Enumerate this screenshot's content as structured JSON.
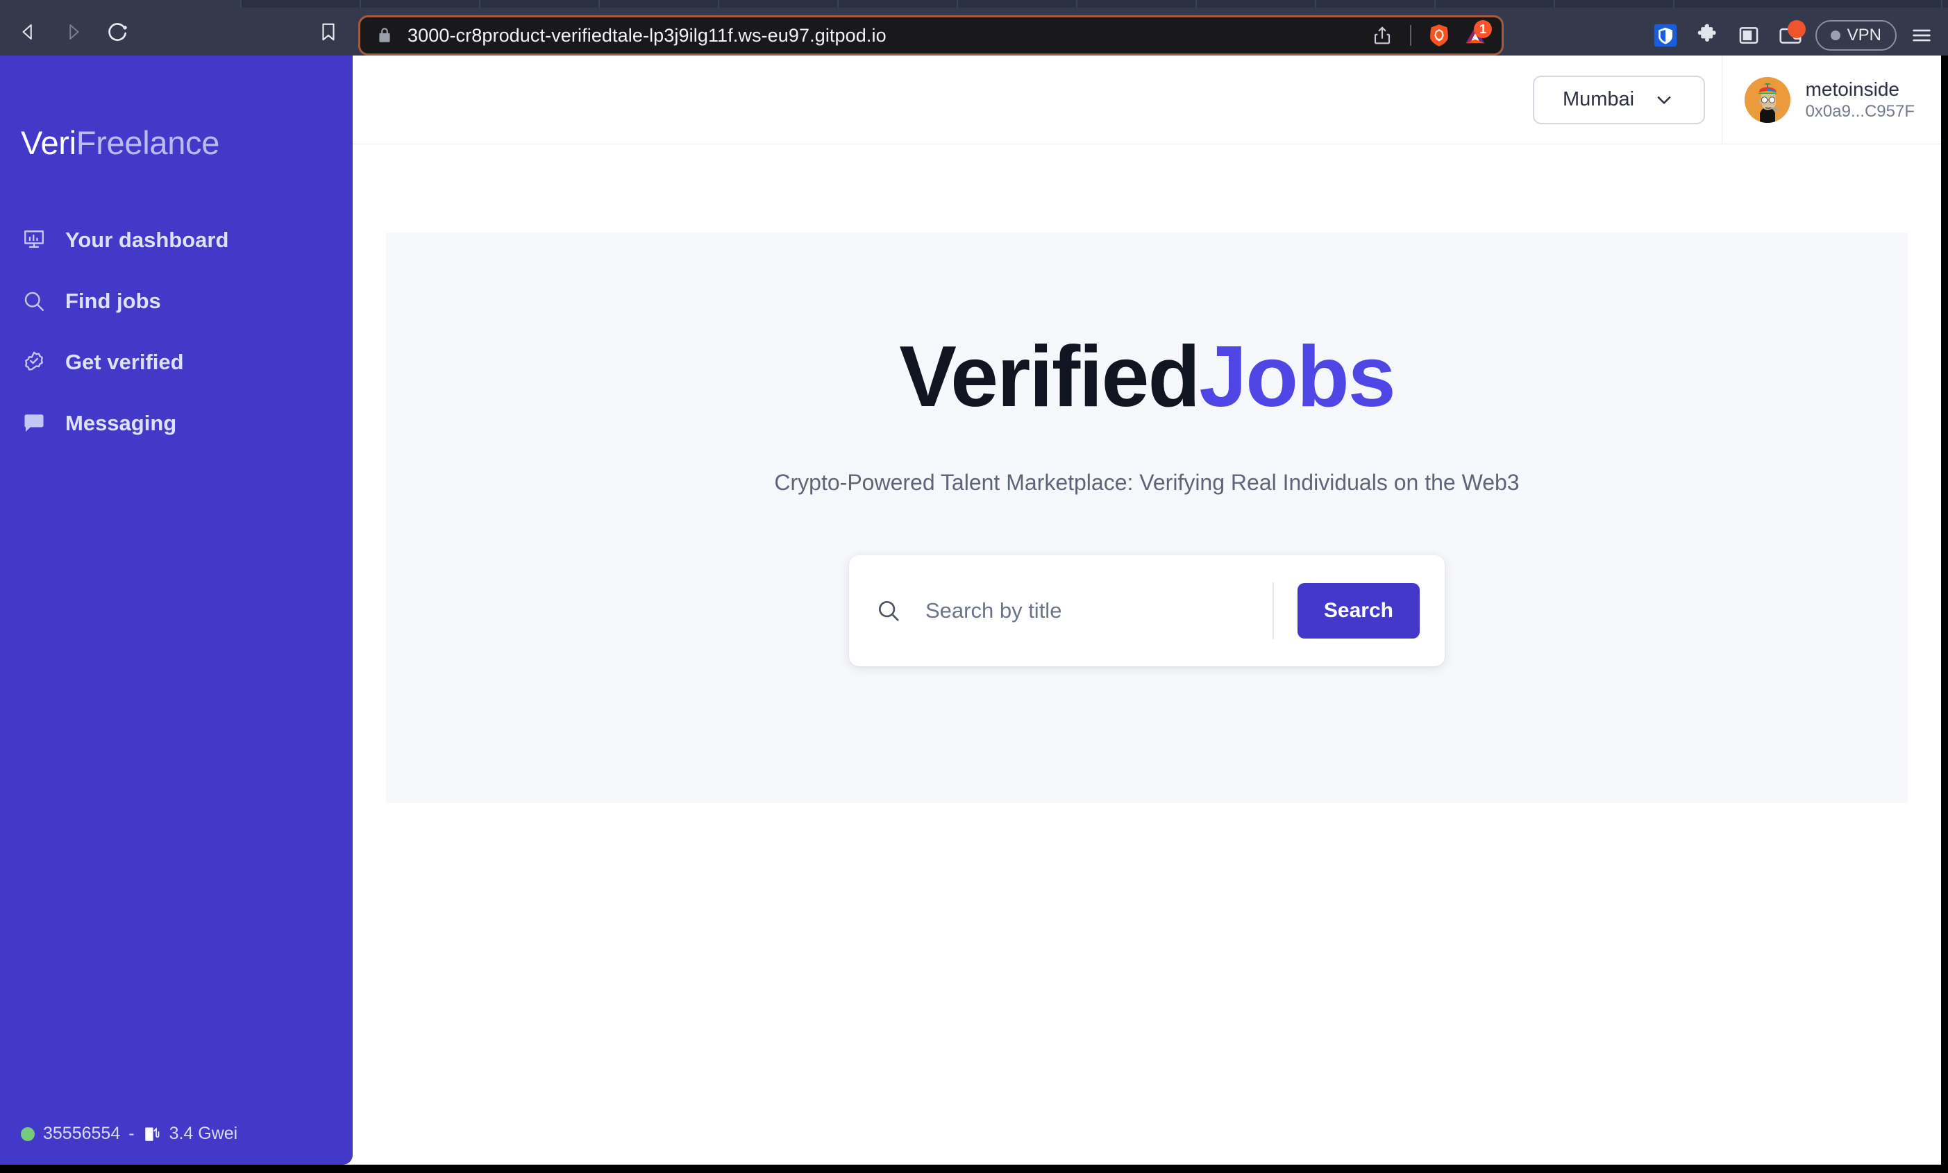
{
  "browser": {
    "url": "3000-cr8product-verifiedtale-lp3j9ilg11f.ws-eu97.gitpod.io",
    "back_label": "Back",
    "forward_label": "Forward",
    "reload_label": "Reload",
    "bookmark_label": "Bookmark",
    "share_label": "Share",
    "brave_shields_label": "Brave Shields",
    "rewards_label": "Brave Rewards",
    "rewards_badge": "1",
    "bitwarden_label": "Bitwarden",
    "extensions_label": "Extensions",
    "sidebar_panel_label": "Side panel",
    "wallet_label": "Brave Wallet",
    "vpn_label": "VPN",
    "menu_label": "Customize and control Brave",
    "lock_label": "Connection is secure"
  },
  "sidebar": {
    "brand_primary": "Veri",
    "brand_secondary": "Freelance",
    "items": [
      {
        "label": "Your dashboard",
        "icon": "dashboard-icon"
      },
      {
        "label": "Find jobs",
        "icon": "search-icon"
      },
      {
        "label": "Get verified",
        "icon": "verified-badge-icon"
      },
      {
        "label": "Messaging",
        "icon": "chat-bubble-icon"
      }
    ],
    "status": {
      "block_number": "35556554",
      "separator": "-",
      "gas_price": "3.4 Gwei"
    }
  },
  "header": {
    "network": "Mumbai",
    "user_name": "metoinside",
    "user_address": "0x0a9...C957F"
  },
  "hero": {
    "title_primary": "Verified",
    "title_secondary": "Jobs",
    "subtitle": "Crypto-Powered Talent Marketplace: Verifying Real Individuals on the Web3",
    "search_placeholder": "Search by title",
    "search_value": "",
    "search_button": "Search"
  },
  "colors": {
    "sidebar_bg": "#4239c9",
    "accent": "#4338ca",
    "hero_accent": "#4f46e5",
    "hero_panel": "#f7f8fb",
    "chrome_bg": "#343a4c",
    "omnibox_bg": "#19191c",
    "omnibox_border": "#a45a3e",
    "status_dot": "#74cc7c",
    "badge": "#fb542b"
  }
}
